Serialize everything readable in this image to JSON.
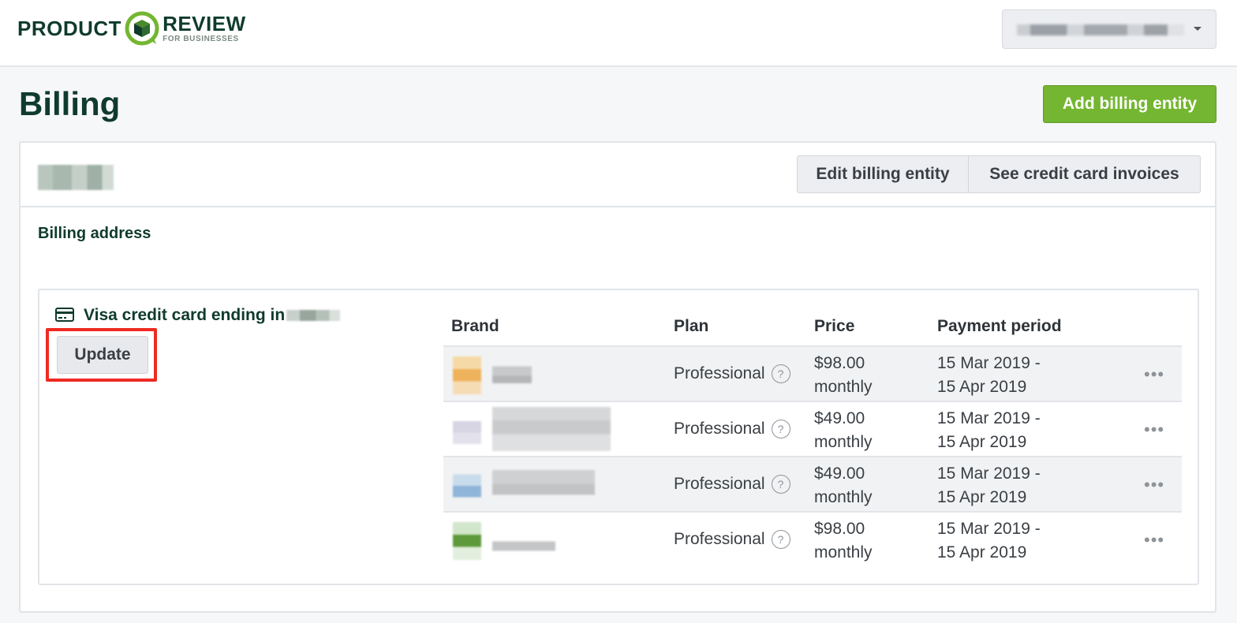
{
  "header": {
    "logo_left": "PRODUCT",
    "logo_right": "REVIEW",
    "logo_sub": "FOR BUSINESSES"
  },
  "page": {
    "title": "Billing",
    "add_button": "Add billing entity"
  },
  "entity": {
    "edit_button": "Edit billing entity",
    "invoices_button": "See credit card invoices",
    "address_label": "Billing address"
  },
  "payment": {
    "card_label": "Visa credit card ending in",
    "update_button": "Update"
  },
  "table": {
    "headers": [
      "Brand",
      "Plan",
      "Price",
      "Payment period"
    ],
    "rows": [
      {
        "plan": "Professional",
        "price": "$98.00",
        "cadence": "monthly",
        "period_start": "15 Mar 2019 -",
        "period_end": "15 Apr 2019"
      },
      {
        "plan": "Professional",
        "price": "$49.00",
        "cadence": "monthly",
        "period_start": "15 Mar 2019 -",
        "period_end": "15 Apr 2019"
      },
      {
        "plan": "Professional",
        "price": "$49.00",
        "cadence": "monthly",
        "period_start": "15 Mar 2019 -",
        "period_end": "15 Apr 2019"
      },
      {
        "plan": "Professional",
        "price": "$98.00",
        "cadence": "monthly",
        "period_start": "15 Mar 2019 -",
        "period_end": "15 Apr 2019"
      }
    ],
    "more_glyph": "•••",
    "help_glyph": "?"
  },
  "colors": {
    "brand_dark": "#0f3b2c",
    "accent_green": "#74b631",
    "highlight_red": "#ee2a22"
  }
}
